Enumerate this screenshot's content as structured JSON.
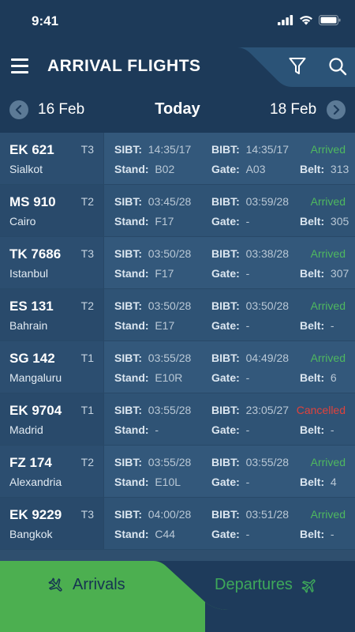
{
  "status_bar": {
    "time": "9:41"
  },
  "header": {
    "title": "ARRIVAL FLIGHTS"
  },
  "date_nav": {
    "prev": "16 Feb",
    "current": "Today",
    "next": "18 Feb"
  },
  "labels": {
    "sibt": "SIBT:",
    "bibt": "BIBT:",
    "stand": "Stand:",
    "gate": "Gate:",
    "belt": "Belt:"
  },
  "colors": {
    "arrived": "#4fb85f",
    "cancelled": "#e0423c",
    "accent_green": "#4caf50"
  },
  "flights": [
    {
      "flight": "EK 621",
      "terminal": "T3",
      "city": "Sialkot",
      "sibt": "14:35/17",
      "bibt": "14:35/17",
      "stand": "B02",
      "gate": "A03",
      "belt": "313",
      "status": "Arrived",
      "status_type": "arrived"
    },
    {
      "flight": "MS 910",
      "terminal": "T2",
      "city": "Cairo",
      "sibt": "03:45/28",
      "bibt": "03:59/28",
      "stand": "F17",
      "gate": "-",
      "belt": "305",
      "status": "Arrived",
      "status_type": "arrived"
    },
    {
      "flight": "TK 7686",
      "terminal": "T3",
      "city": "Istanbul",
      "sibt": "03:50/28",
      "bibt": "03:38/28",
      "stand": "F17",
      "gate": "-",
      "belt": "307",
      "status": "Arrived",
      "status_type": "arrived"
    },
    {
      "flight": "ES 131",
      "terminal": "T2",
      "city": "Bahrain",
      "sibt": "03:50/28",
      "bibt": "03:50/28",
      "stand": "E17",
      "gate": "-",
      "belt": "-",
      "status": "Arrived",
      "status_type": "arrived"
    },
    {
      "flight": "SG 142",
      "terminal": "T1",
      "city": "Mangaluru",
      "sibt": "03:55/28",
      "bibt": "04:49/28",
      "stand": "E10R",
      "gate": "-",
      "belt": "6",
      "status": "Arrived",
      "status_type": "arrived"
    },
    {
      "flight": "EK 9704",
      "terminal": "T1",
      "city": "Madrid",
      "sibt": "03:55/28",
      "bibt": "23:05/27",
      "stand": "-",
      "gate": "-",
      "belt": "-",
      "status": "Cancelled",
      "status_type": "cancelled"
    },
    {
      "flight": "FZ 174",
      "terminal": "T2",
      "city": "Alexandria",
      "sibt": "03:55/28",
      "bibt": "03:55/28",
      "stand": "E10L",
      "gate": "-",
      "belt": "4",
      "status": "Arrived",
      "status_type": "arrived"
    },
    {
      "flight": "EK 9229",
      "terminal": "T3",
      "city": "Bangkok",
      "sibt": "04:00/28",
      "bibt": "03:51/28",
      "stand": "C44",
      "gate": "-",
      "belt": "-",
      "status": "Arrived",
      "status_type": "arrived"
    }
  ],
  "tabs": {
    "arrivals": "Arrivals",
    "departures": "Departures",
    "active": "arrivals"
  },
  "icons": {
    "menu": "hamburger-icon",
    "filter": "filter-icon",
    "search": "search-icon",
    "prev": "chevron-left-icon",
    "next": "chevron-right-icon",
    "arrivals": "plane-landing-icon",
    "departures": "plane-takeoff-icon"
  }
}
